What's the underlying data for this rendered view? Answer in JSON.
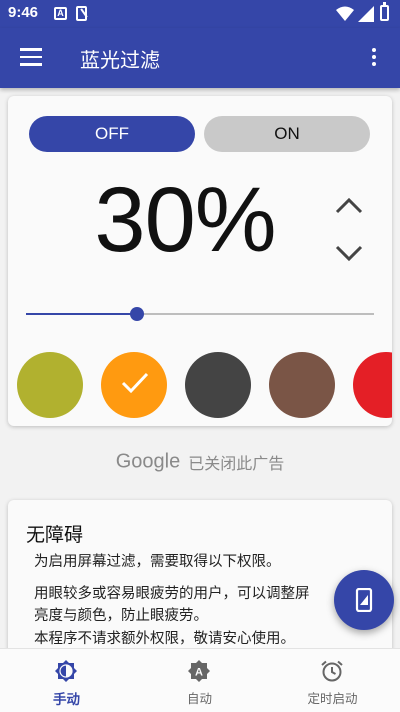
{
  "status_bar": {
    "time": "9:46",
    "notif_a": "A"
  },
  "app_bar": {
    "title": "蓝光过滤",
    "menu_icon": "hamburger-menu-icon",
    "overflow_icon": "more-vert-icon"
  },
  "filter": {
    "off_label": "OFF",
    "on_label": "ON",
    "active": "OFF",
    "intensity_text": "30%",
    "intensity_fraction": 0.32,
    "increase_icon": "chevron-up-icon",
    "decrease_icon": "chevron-down-icon",
    "swatches": [
      {
        "name": "olive",
        "color": "#b1b12f",
        "selected": false
      },
      {
        "name": "orange",
        "color": "#ff9a10",
        "selected": true
      },
      {
        "name": "dark-gray",
        "color": "#444444",
        "selected": false
      },
      {
        "name": "brown",
        "color": "#7a5546",
        "selected": false
      },
      {
        "name": "red",
        "color": "#e41f26",
        "selected": false
      }
    ]
  },
  "ad": {
    "brand": "Google",
    "text": "已关闭此广告"
  },
  "accessibility": {
    "title": "无障碍",
    "lines": [
      "为启用屏幕过滤，需要取得以下权限。",
      "用眼较多或容易眼疲劳的用户，可以调整屏",
      "亮度与颜色，防止眼疲劳。",
      "本程序不请求额外权限，敬请安心使用。"
    ]
  },
  "fab": {
    "icon": "screen-filter-icon"
  },
  "bottom_nav": [
    {
      "label": "手动",
      "icon": "manual-brightness-icon",
      "active": true
    },
    {
      "label": "自动",
      "icon": "auto-brightness-icon",
      "active": false
    },
    {
      "label": "定时启动",
      "icon": "alarm-clock-icon",
      "active": false
    }
  ],
  "colors": {
    "primary": "#3546a8",
    "inactive_toggle": "#c9c9c9"
  }
}
